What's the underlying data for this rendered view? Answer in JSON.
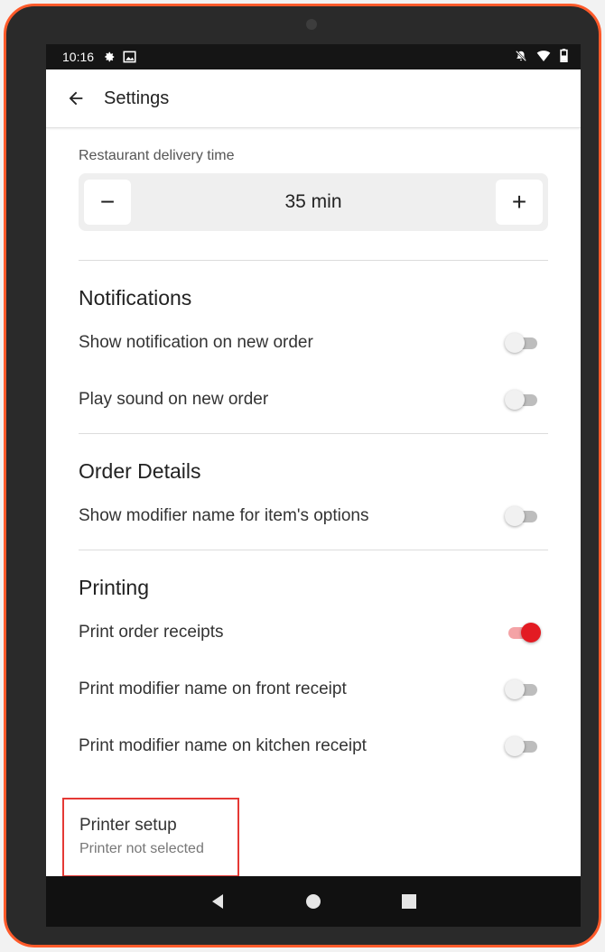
{
  "status_bar": {
    "time": "10:16",
    "left_icons": [
      "gear-icon",
      "image-icon"
    ],
    "right_icons": [
      "notifications-off-icon",
      "wifi-icon",
      "battery-icon"
    ]
  },
  "app_bar": {
    "title": "Settings",
    "back_icon": "arrow-back-icon"
  },
  "delivery_time": {
    "label": "Restaurant delivery time",
    "value": "35 min",
    "decrement": "−",
    "increment": "+"
  },
  "notifications": {
    "title": "Notifications",
    "items": [
      {
        "label": "Show notification on new order",
        "enabled": false
      },
      {
        "label": "Play sound on new order",
        "enabled": false
      }
    ]
  },
  "order_details": {
    "title": "Order Details",
    "items": [
      {
        "label": "Show modifier name for item's options",
        "enabled": false
      }
    ]
  },
  "printing": {
    "title": "Printing",
    "items": [
      {
        "label": "Print order receipts",
        "enabled": true
      },
      {
        "label": "Print modifier name on front receipt",
        "enabled": false
      },
      {
        "label": "Print modifier name on kitchen receipt",
        "enabled": false
      }
    ],
    "printer_setup": {
      "title": "Printer setup",
      "subtitle": "Printer not selected"
    }
  },
  "nav_bar": {
    "icons": [
      "back-triangle-icon",
      "home-circle-icon",
      "recents-square-icon"
    ]
  },
  "colors": {
    "accent": "#e31b23",
    "highlight_border": "#e53935",
    "device_frame": "#ff5a2a"
  }
}
